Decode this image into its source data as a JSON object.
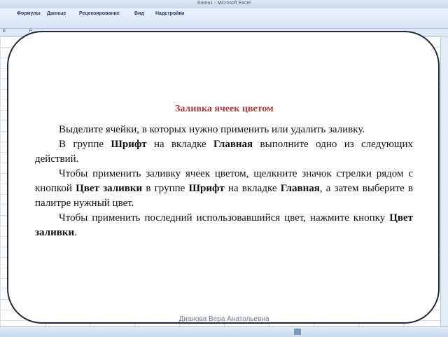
{
  "window": {
    "title": "Книга1 - Microsoft Excel"
  },
  "ribbon": {
    "tabs": [
      "Формулы",
      "Данные",
      "Рецензирование",
      "Вид",
      "Надстройки"
    ]
  },
  "columns": [
    "E",
    "F"
  ],
  "slide": {
    "heading": "Заливка ячеек цветом",
    "paragraphs": [
      [
        "Выделите ячейки, в которых нужно применить или удалить заливку."
      ],
      [
        "В группе ",
        "Шрифт",
        " на вкладке ",
        "Главная",
        " выполните одно из следующих действий."
      ],
      [
        "Чтобы применить заливку ячеек цветом, щелкните значок стрелки рядом с кнопкой ",
        "Цвет заливки",
        " в группе ",
        "Шрифт",
        " на вкладке ",
        "Главная",
        ", а затем выберите в палитре нужный цвет."
      ],
      [
        "Чтобы применить последний использовавшийся цвет, нажмите кнопку ",
        "Цвет заливки",
        "."
      ]
    ],
    "footer": "Дианова Вера Анатольевна"
  }
}
